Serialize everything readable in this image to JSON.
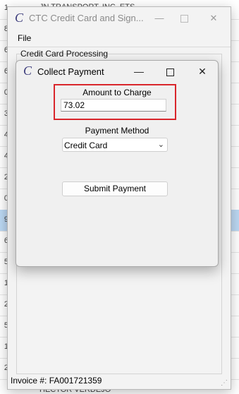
{
  "background": {
    "row_numbers": [
      "1",
      "8",
      "6",
      "6",
      "0",
      "3",
      "4",
      "4",
      "2",
      "0",
      "9",
      "6",
      "5",
      "1",
      "2",
      "5",
      "1",
      "2"
    ],
    "top_text": "JN TRANSPORT, INC. ETS",
    "bottom_text": "HECTOR VERDEJO"
  },
  "main_window": {
    "title": "CTC Credit Card and Sign...",
    "menu": {
      "file_label": "File"
    },
    "group_label": "Credit Card Processing",
    "status_text": "Invoice #: FA001721359"
  },
  "dialog": {
    "title": "Collect Payment",
    "amount_label": "Amount to Charge",
    "amount_value": "73.02",
    "payment_method_label": "Payment Method",
    "payment_method_value": "Credit Card",
    "submit_label": "Submit Payment"
  },
  "colors": {
    "highlight": "#d9262c",
    "selected_row": "#bcd8f3"
  }
}
